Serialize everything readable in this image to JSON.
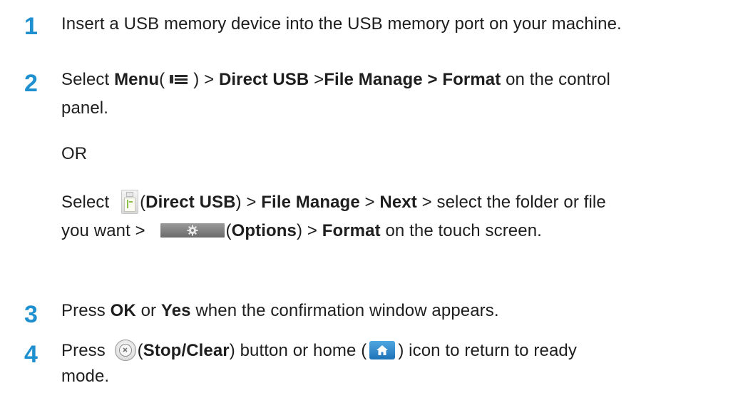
{
  "steps": [
    {
      "number": "1",
      "line1": "Insert a USB memory device into the USB memory port on your machine."
    },
    {
      "number": "2",
      "a_select": "Select ",
      "a_menu": "Menu",
      "a_paren_open": "(",
      "a_paren_close": ") > ",
      "a_direct_usb": "Direct USB",
      "a_sep1": " >",
      "a_file_manage_format": "File Manage > Format",
      "a_tail": " on the control",
      "a_line2": "panel.",
      "or": "OR",
      "b_select": "Select ",
      "b_paren_open": "(",
      "b_direct_usb": "Direct USB",
      "b_sep1": ") > ",
      "b_file_manage": "File Manage",
      "b_sep2": " > ",
      "b_next": "Next",
      "b_tail1": " > select the folder or file",
      "b_line2_start": "you want > ",
      "b_paren_open2": "(",
      "b_options": "Options",
      "b_sep3": ") > ",
      "b_format": "Format",
      "b_tail2": " on the touch screen."
    },
    {
      "number": "3",
      "press": "Press ",
      "ok": "OK",
      "or_word": " or ",
      "yes": "Yes",
      "tail": " when the confirmation window appears."
    },
    {
      "number": "4",
      "press": "Press ",
      "paren_open": "(",
      "stop_clear": "Stop/Clear",
      "mid": ") button or home (",
      "tail": ") icon to return to ready",
      "line2": "mode."
    }
  ],
  "icons": {
    "menu": "menu-icon",
    "direct_usb": "usb-memory-icon",
    "options": "gear-icon",
    "stop_clear": "stop-clear-icon",
    "home": "home-icon"
  },
  "colors": {
    "step_number": "#1e8fcf",
    "text": "#1e1e1e"
  }
}
